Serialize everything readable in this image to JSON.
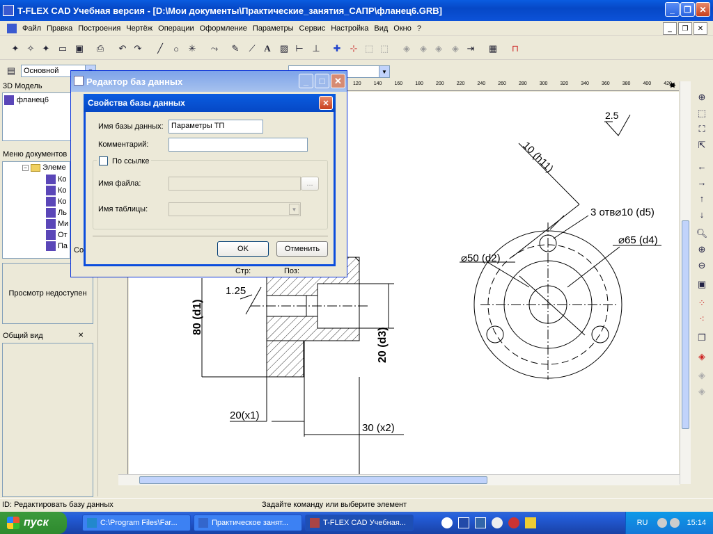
{
  "window": {
    "title": "T-FLEX CAD Учебная версия - [D:\\Мои документы\\Практические_занятия_САПР\\фланец6.GRB]"
  },
  "menu": [
    "Файл",
    "Правка",
    "Построения",
    "Чертёж",
    "Операции",
    "Оформление",
    "Параметры",
    "Сервис",
    "Настройка",
    "Вид",
    "Окно",
    "?"
  ],
  "layer_combo": "Основной",
  "left": {
    "model_header": "3D Модель",
    "model_item": "фланец6",
    "docmenu_header": "Меню документов",
    "tree_items": [
      "Элеме",
      "Ко",
      "Ко",
      "Ко",
      "Ль",
      "Ми",
      "От",
      "Па"
    ],
    "preview_text": "Просмотр недоступен",
    "general_view": "Общий вид"
  },
  "ruler_ticks": [
    "120",
    "140",
    "160",
    "180",
    "200",
    "220",
    "240",
    "260",
    "280",
    "300",
    "320",
    "340",
    "360",
    "380",
    "400",
    "420"
  ],
  "drawing": {
    "roughness": "2.5",
    "dim_h11": "10 (h11)",
    "dim_d5": "3 отв⌀10 (d5)",
    "dim_d4": "⌀65 (d4)",
    "dim_d2": "⌀50 (d2)",
    "dim_d1": "80 (d1)",
    "chamfer": "1.25",
    "dim_d3": "20 (d3)",
    "dim_x1": "20(x1)",
    "dim_x2": "30 (x2)"
  },
  "db_editor": {
    "title": "Редактор баз данных",
    "behind_str": "Стр:",
    "behind_poz": "Поз:",
    "behind_so": "Со"
  },
  "db_props": {
    "title": "Свойства базы данных",
    "name_label": "Имя базы данных:",
    "name_value": "Параметры ТП",
    "comment_label": "Комментарий:",
    "comment_value": "",
    "link_label": "По ссылке",
    "file_label": "Имя файла:",
    "table_label": "Имя таблицы:",
    "browse": "...",
    "ok": "OK",
    "cancel": "Отменить"
  },
  "status": {
    "left": "ID: Редактировать базу данных",
    "right": "Задайте команду или выберите элемент"
  },
  "taskbar": {
    "start": "пуск",
    "tasks": [
      "C:\\Program Files\\Far...",
      "Практическое занят...",
      "T-FLEX CAD Учебная..."
    ],
    "lang": "RU",
    "time": "15:14"
  }
}
